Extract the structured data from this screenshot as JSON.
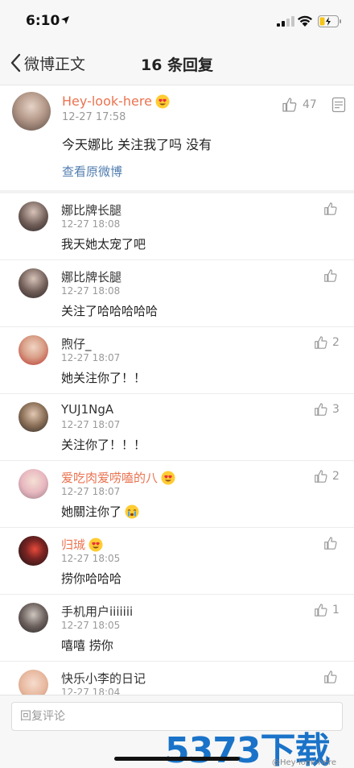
{
  "status_bar": {
    "time": "6:10"
  },
  "nav": {
    "back_label": "微博正文",
    "title": "16 条回复"
  },
  "main_post": {
    "author": "Hey-look-here",
    "time": "12-27 17:58",
    "like_count": "47",
    "text": "今天娜比 关注我了吗 没有",
    "view_original": "查看原微博"
  },
  "replies": [
    {
      "name": "娜比牌长腿",
      "time": "12-27 18:08",
      "text": "我天她太宠了吧",
      "like_count": ""
    },
    {
      "name": "娜比牌长腿",
      "time": "12-27 18:08",
      "text": "关注了哈哈哈哈哈",
      "like_count": ""
    },
    {
      "name": "煦仔_",
      "time": "12-27 18:07",
      "text": "她关注你了！！",
      "like_count": "2"
    },
    {
      "name": "YUJ1NgA",
      "time": "12-27 18:07",
      "text": "关注你了！！！",
      "like_count": "3"
    },
    {
      "name": "爱吃肉爱唠嗑的八",
      "time": "12-27 18:07",
      "text": "她關注你了",
      "like_count": "2"
    },
    {
      "name": "归珹",
      "time": "12-27 18:05",
      "text": "捞你哈哈哈",
      "like_count": ""
    },
    {
      "name": "手机用户iiiiiii",
      "time": "12-27 18:05",
      "text": "嘻嘻 捞你",
      "like_count": "1"
    },
    {
      "name": "快乐小李的日记",
      "time": "12-27 18:04",
      "text": "",
      "like_count": ""
    }
  ],
  "bottom": {
    "reply_placeholder": "回复评论",
    "watermark": "5373下载",
    "watermark_sub": "@Hey-look-here"
  },
  "colors": {
    "vip_name": "#eb7350",
    "link": "#507daf",
    "watermark": "#1a73c8"
  },
  "icons": [
    "location-arrow-icon",
    "signal-icon",
    "wifi-icon",
    "battery-icon",
    "back-chevron-icon",
    "thumbs-up-icon",
    "more-icon",
    "heart-eyes-emoji-icon",
    "crying-emoji-icon"
  ]
}
